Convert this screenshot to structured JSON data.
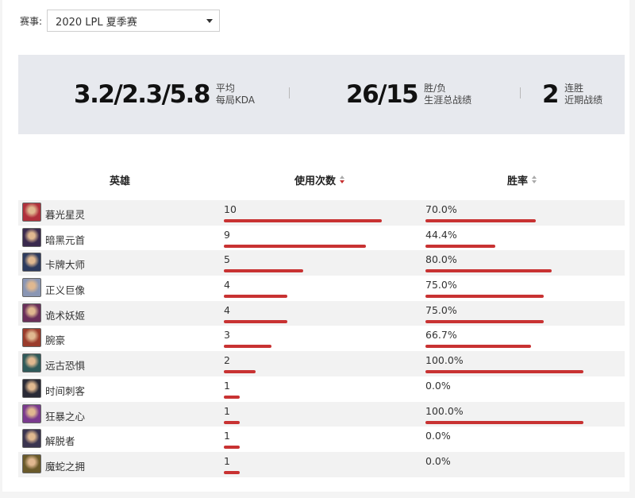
{
  "season": {
    "label": "赛事:",
    "selected": "2020 LPL 夏季赛"
  },
  "stats": {
    "kda_value": "3.2/2.3/5.8",
    "kda_label_top": "平均",
    "kda_label_bottom": "每局KDA",
    "record_value": "26/15",
    "record_label_top": "胜/负",
    "record_label_bottom": "生涯总战绩",
    "streak_value": "2",
    "streak_label_top": "连胜",
    "streak_label_bottom": "近期战绩"
  },
  "table": {
    "headers": {
      "hero": "英雄",
      "uses": "使用次数",
      "winrate": "胜率"
    },
    "rows": [
      {
        "hero": "暮光星灵",
        "uses": "10",
        "uses_value": 10,
        "winrate": "70.0%",
        "winrate_value": 70.0,
        "avatar_color": "#b0303c"
      },
      {
        "hero": "暗黑元首",
        "uses": "9",
        "uses_value": 9,
        "winrate": "44.4%",
        "winrate_value": 44.4,
        "avatar_color": "#3a2a4e"
      },
      {
        "hero": "卡牌大师",
        "uses": "5",
        "uses_value": 5,
        "winrate": "80.0%",
        "winrate_value": 80.0,
        "avatar_color": "#2c3a5e"
      },
      {
        "hero": "正义巨像",
        "uses": "4",
        "uses_value": 4,
        "winrate": "75.0%",
        "winrate_value": 75.0,
        "avatar_color": "#8a96b4"
      },
      {
        "hero": "诡术妖姬",
        "uses": "4",
        "uses_value": 4,
        "winrate": "75.0%",
        "winrate_value": 75.0,
        "avatar_color": "#6a2f5a"
      },
      {
        "hero": "腕豪",
        "uses": "3",
        "uses_value": 3,
        "winrate": "66.7%",
        "winrate_value": 66.7,
        "avatar_color": "#9a3c2c"
      },
      {
        "hero": "远古恐惧",
        "uses": "2",
        "uses_value": 2,
        "winrate": "100.0%",
        "winrate_value": 100.0,
        "avatar_color": "#2f5a5a"
      },
      {
        "hero": "时间刺客",
        "uses": "1",
        "uses_value": 1,
        "winrate": "0.0%",
        "winrate_value": 0.0,
        "avatar_color": "#2a2a36"
      },
      {
        "hero": "狂暴之心",
        "uses": "1",
        "uses_value": 1,
        "winrate": "100.0%",
        "winrate_value": 100.0,
        "avatar_color": "#7a3a8e"
      },
      {
        "hero": "解脱者",
        "uses": "1",
        "uses_value": 1,
        "winrate": "0.0%",
        "winrate_value": 0.0,
        "avatar_color": "#3a3450"
      },
      {
        "hero": "魔蛇之拥",
        "uses": "1",
        "uses_value": 1,
        "winrate": "0.0%",
        "winrate_value": 0.0,
        "avatar_color": "#6a5a2a"
      }
    ]
  },
  "colors": {
    "bar": "#c83232",
    "panel": "#e7e9ee",
    "row_alt": "#f2f2f2"
  }
}
